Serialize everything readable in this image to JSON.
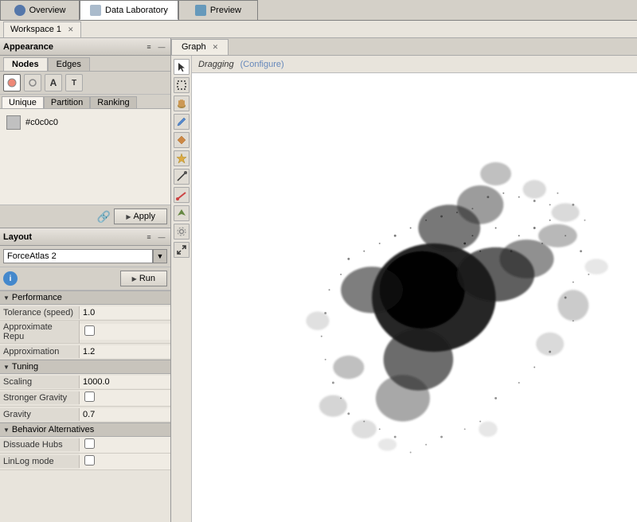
{
  "top_tabs": [
    {
      "id": "overview",
      "label": "Overview",
      "icon": "globe"
    },
    {
      "id": "data-laboratory",
      "label": "Data Laboratory",
      "icon": "table",
      "active": true
    },
    {
      "id": "preview",
      "label": "Preview",
      "icon": "eye"
    }
  ],
  "workspace": {
    "tab_label": "Workspace 1"
  },
  "appearance": {
    "title": "Appearance",
    "node_tab": "Nodes",
    "edge_tab": "Edges",
    "sub_tabs": [
      "Unique",
      "Partition",
      "Ranking"
    ],
    "color_swatch": "#c0c0c0",
    "color_label": "#c0c0c0",
    "apply_label": "Apply"
  },
  "layout": {
    "title": "Layout",
    "algorithm": "ForceAtlas 2",
    "run_label": "Run",
    "sections": [
      {
        "name": "Performance",
        "props": [
          {
            "key": "Tolerance (speed)",
            "value": "1.0",
            "type": "text"
          },
          {
            "key": "Approximate Repu",
            "value": "",
            "type": "checkbox"
          },
          {
            "key": "Approximation",
            "value": "1.2",
            "type": "text"
          }
        ]
      },
      {
        "name": "Tuning",
        "props": [
          {
            "key": "Scaling",
            "value": "1000.0",
            "type": "text"
          },
          {
            "key": "Stronger Gravity",
            "value": "",
            "type": "checkbox"
          },
          {
            "key": "Gravity",
            "value": "0.7",
            "type": "text"
          }
        ]
      },
      {
        "name": "Behavior Alternatives",
        "props": [
          {
            "key": "Dissuade Hubs",
            "value": "",
            "type": "checkbox"
          },
          {
            "key": "LinLog mode",
            "value": "",
            "type": "checkbox"
          }
        ]
      }
    ]
  },
  "graph": {
    "tab_label": "Graph",
    "dragging_label": "Dragging",
    "configure_label": "(Configure)",
    "toolbar_icons": [
      "arrow",
      "dotted-rect",
      "hand",
      "pencil",
      "diamond",
      "star",
      "pencil2",
      "pencil3",
      "plane",
      "gear",
      "arrow-select"
    ]
  }
}
